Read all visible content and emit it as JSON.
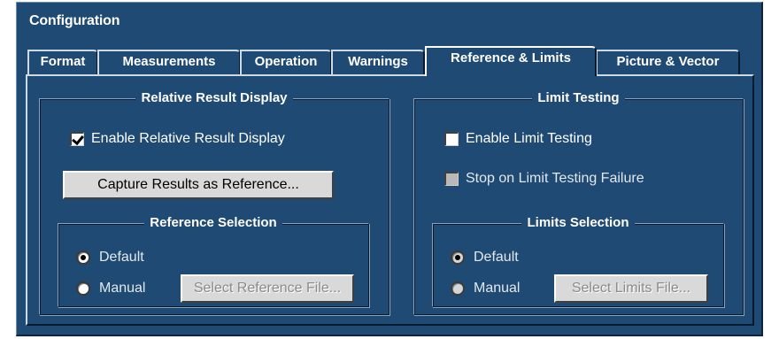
{
  "window": {
    "title": "Configuration"
  },
  "tabs": [
    {
      "label": "Format",
      "active": false
    },
    {
      "label": "Measurements",
      "active": false
    },
    {
      "label": "Operation",
      "active": false
    },
    {
      "label": "Warnings",
      "active": false
    },
    {
      "label": "Reference & Limits",
      "active": true
    },
    {
      "label": "Picture & Vector",
      "active": false
    }
  ],
  "relative": {
    "title": "Relative Result Display",
    "enable_label": "Enable Relative Result Display",
    "enable_checked": true,
    "capture_button": "Capture Results as Reference...",
    "selection": {
      "title": "Reference Selection",
      "default_label": "Default",
      "manual_label": "Manual",
      "selected": "Default",
      "select_file_button": "Select Reference File..."
    }
  },
  "limits": {
    "title": "Limit Testing",
    "enable_label": "Enable Limit Testing",
    "enable_checked": false,
    "stop_label": "Stop on Limit Testing Failure",
    "stop_checked": false,
    "selection": {
      "title": "Limits Selection",
      "default_label": "Default",
      "manual_label": "Manual",
      "selected": "Default",
      "select_file_button": "Select Limits File..."
    }
  },
  "colors": {
    "panel": "#1f4a73",
    "button": "#d9d9d9",
    "text": "#ffffff"
  }
}
